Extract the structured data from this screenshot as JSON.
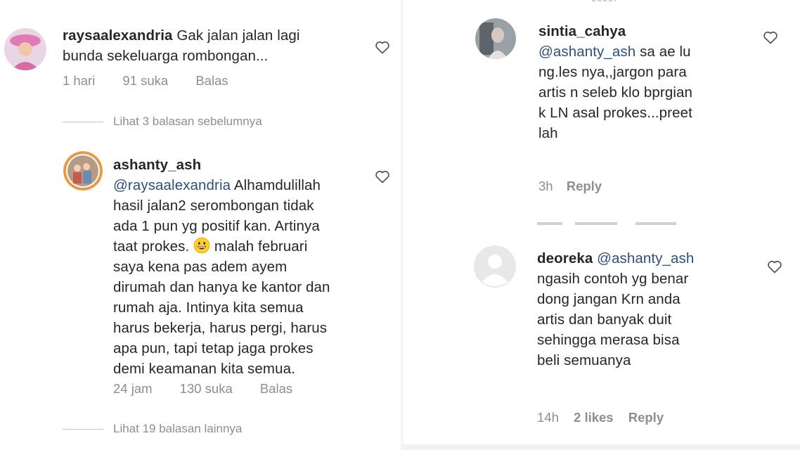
{
  "left": {
    "comment1": {
      "username": "raysaalexandria",
      "text_line1": "Gak jalan jalan lagi",
      "text_line2": "bunda sekeluarga rombongan...",
      "time": "1 hari",
      "likes": "91 suka",
      "reply": "Balas"
    },
    "view_prev": "Lihat 3 balasan sebelumnya",
    "reply1": {
      "username": "ashanty_ash",
      "mention": "@raysaalexandria",
      "lines": [
        "Alhamdulillah",
        "hasil jalan2 serombongan tidak",
        "ada 1 pun yg positif kan. Artinya",
        "taat prokes.",
        "malah februari",
        "saya kena pas adem ayem",
        "dirumah dan hanya ke kantor dan",
        "rumah aja. Intinya kita semua",
        "harus bekerja, harus pergi, harus",
        "apa pun, tapi tetap jaga prokes",
        "demi keamanan kita semua."
      ],
      "time": "24 jam",
      "likes": "130 suka",
      "reply": "Balas"
    },
    "view_more": "Lihat 19 balasan lainnya"
  },
  "right": {
    "comment1": {
      "username": "sintia_cahya",
      "mention": "@ashanty_ash",
      "lines": [
        "sa ae lu",
        "ng.les nya,,jargon para",
        "artis n seleb klo bprgian",
        "k LN asal prokes...preet",
        "lah"
      ],
      "time": "3h",
      "reply": "Reply"
    },
    "comment2": {
      "username": "deoreka",
      "mention": "@ashanty_ash",
      "lines": [
        "ngasih contoh yg benar",
        "dong jangan Krn anda",
        "artis dan banyak duit",
        "sehingga merasa bisa",
        "beli semuanya"
      ],
      "time": "14h",
      "likes": "2 likes",
      "reply": "Reply"
    }
  },
  "icons": {
    "heart": "heart-icon",
    "emoji": "grinning-face-emoji"
  },
  "colors": {
    "mention": "#2d4f7c",
    "meta": "#8e8e8e",
    "text": "#262626"
  }
}
